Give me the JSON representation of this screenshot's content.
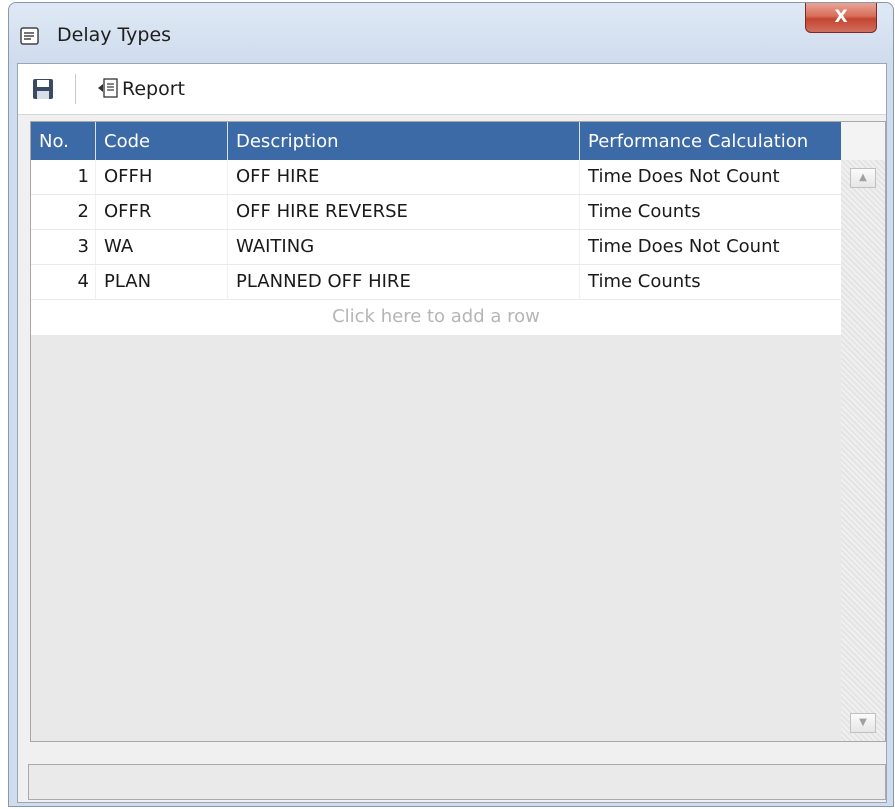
{
  "window": {
    "title": "Delay Types",
    "close_label": "X",
    "icon": "list-window-icon"
  },
  "toolbar": {
    "save_icon": "save-floppy-icon",
    "report_icon": "report-icon",
    "report_label": "Report"
  },
  "grid": {
    "columns": [
      "No.",
      "Code",
      "Description",
      "Performance Calculation"
    ],
    "rows": [
      {
        "no": "1",
        "code": "OFFH",
        "description": "OFF HIRE",
        "performance": "Time Does Not Count"
      },
      {
        "no": "2",
        "code": "OFFR",
        "description": "OFF HIRE REVERSE",
        "performance": "Time Counts"
      },
      {
        "no": "3",
        "code": "WA",
        "description": "WAITING",
        "performance": "Time Does Not Count"
      },
      {
        "no": "4",
        "code": "PLAN",
        "description": "PLANNED OFF HIRE",
        "performance": "Time Counts"
      }
    ],
    "add_row_text": "Click here to add a row"
  },
  "colors": {
    "header_bg": "#3c6aa7",
    "close_button": "#c34530"
  }
}
